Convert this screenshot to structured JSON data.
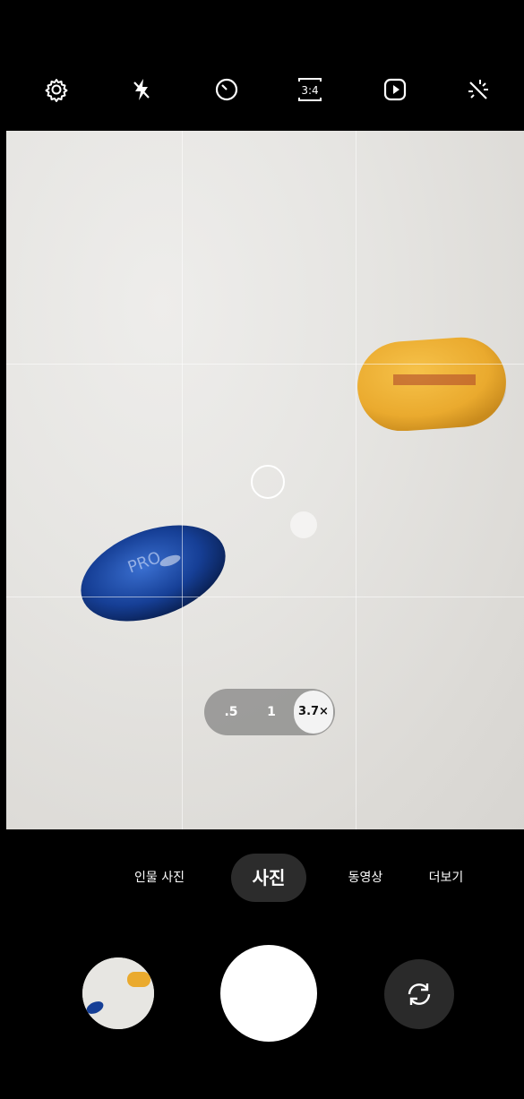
{
  "top_toolbar": {
    "icons": [
      "settings-icon",
      "flash-off-icon",
      "timer-icon",
      "aspect-ratio-icon",
      "motion-photo-icon",
      "filter-effects-icon"
    ],
    "aspect_ratio_label": "3:4"
  },
  "viewfinder": {
    "pill_text": "PRO"
  },
  "zoom": {
    "options": [
      ".5",
      "1"
    ],
    "active": "3.7×"
  },
  "modes": {
    "portrait": "인물 사진",
    "photo": "사진",
    "video": "동영상",
    "more": "더보기",
    "selected": "사진"
  },
  "colors": {
    "accent": "#ffffff",
    "background": "#000000"
  }
}
